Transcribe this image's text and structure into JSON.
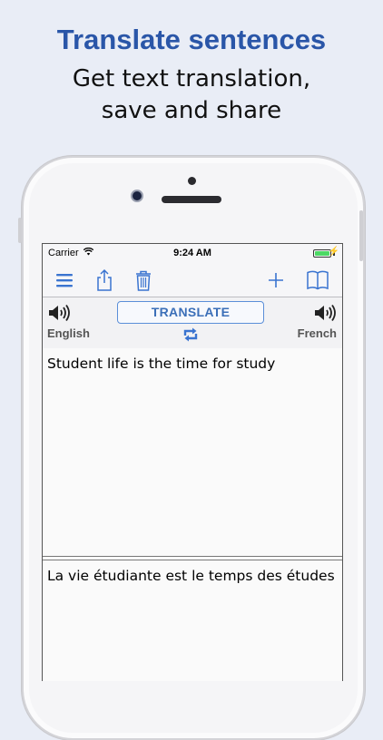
{
  "promo": {
    "headline": "Translate sentences",
    "subline_1": "Get text translation,",
    "subline_2": "save and share"
  },
  "status": {
    "carrier": "Carrier",
    "time": "9:24 AM"
  },
  "toolbar": {
    "icons": [
      "menu-icon",
      "share-icon",
      "trash-icon",
      "add-icon",
      "book-icon"
    ]
  },
  "language": {
    "source": "English",
    "target": "French",
    "translate_label": "TRANSLATE"
  },
  "text": {
    "source": "Student life is the time for study",
    "translation": "La vie étudiante est le temps des études"
  },
  "colors": {
    "headline": "#2a56a8",
    "accent": "#3a74d0",
    "background": "#e9edf6"
  }
}
